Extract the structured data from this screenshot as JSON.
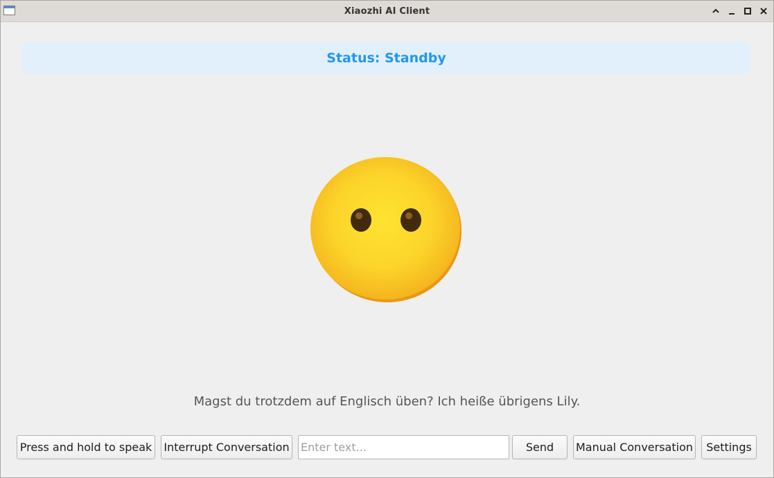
{
  "window": {
    "title": "Xiaozhi AI Client"
  },
  "titlebar_buttons": [
    {
      "name": "shade",
      "icon": "chevron-up-icon"
    },
    {
      "name": "minimize",
      "icon": "minimize-icon"
    },
    {
      "name": "maximize",
      "icon": "maximize-icon"
    },
    {
      "name": "close",
      "icon": "close-icon"
    }
  ],
  "status": {
    "text": "Status: Standby",
    "color": "#2196f3",
    "background": "#e2f0fb"
  },
  "emotion": {
    "icon": "neutral-face-icon"
  },
  "message": {
    "text": "Magst du trotzdem auf Englisch üben? Ich heiße übrigens Lily."
  },
  "controls": {
    "push_to_talk_label": "Press and hold to speak",
    "interrupt_label": "Interrupt Conversation",
    "text_input": {
      "value": "",
      "placeholder": "Enter text..."
    },
    "send_label": "Send",
    "mode_label": "Manual Conversation",
    "settings_label": "Settings"
  }
}
